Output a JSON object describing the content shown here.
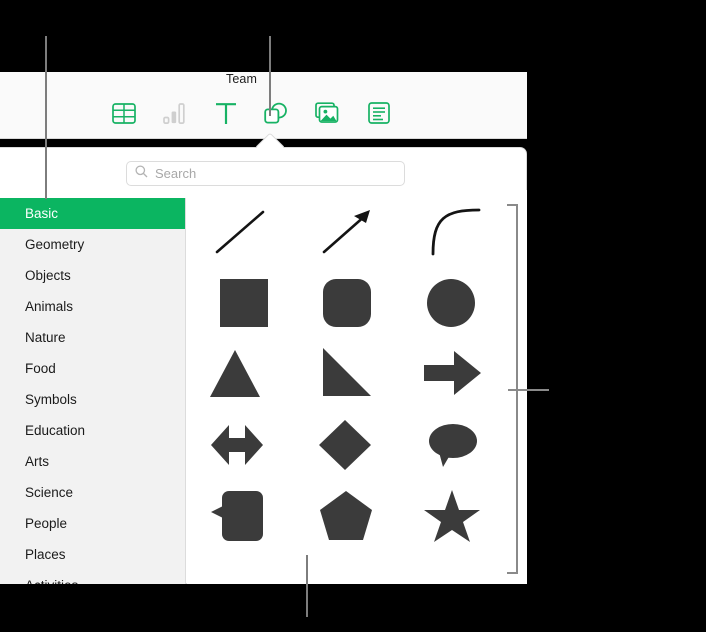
{
  "window": {
    "toolbar_title": "Team",
    "accent_color": "#0bb561",
    "toolbar_icons": [
      {
        "name": "table-icon",
        "label": "Table",
        "state": "enabled"
      },
      {
        "name": "chart-icon",
        "label": "Chart",
        "state": "disabled"
      },
      {
        "name": "text-icon",
        "label": "Text",
        "state": "enabled"
      },
      {
        "name": "shape-icon",
        "label": "Shape",
        "state": "active"
      },
      {
        "name": "media-icon",
        "label": "Media",
        "state": "enabled"
      },
      {
        "name": "comment-icon",
        "label": "Comment",
        "state": "enabled"
      }
    ]
  },
  "popover": {
    "search": {
      "placeholder": "Search",
      "value": "",
      "icon": "search-icon"
    },
    "categories": [
      {
        "label": "Basic",
        "selected": true
      },
      {
        "label": "Geometry",
        "selected": false
      },
      {
        "label": "Objects",
        "selected": false
      },
      {
        "label": "Animals",
        "selected": false
      },
      {
        "label": "Nature",
        "selected": false
      },
      {
        "label": "Food",
        "selected": false
      },
      {
        "label": "Symbols",
        "selected": false
      },
      {
        "label": "Education",
        "selected": false
      },
      {
        "label": "Arts",
        "selected": false
      },
      {
        "label": "Science",
        "selected": false
      },
      {
        "label": "People",
        "selected": false
      },
      {
        "label": "Places",
        "selected": false
      },
      {
        "label": "Activities",
        "selected": false
      }
    ],
    "shapes": [
      {
        "name": "line-shape",
        "label": "Line"
      },
      {
        "name": "arrow-shape",
        "label": "Arrow"
      },
      {
        "name": "curved-line-shape",
        "label": "Curved Line"
      },
      {
        "name": "square-shape",
        "label": "Square"
      },
      {
        "name": "rounded-square-shape",
        "label": "Rounded Square"
      },
      {
        "name": "circle-shape",
        "label": "Circle"
      },
      {
        "name": "triangle-shape",
        "label": "Triangle"
      },
      {
        "name": "right-triangle-shape",
        "label": "Right Triangle"
      },
      {
        "name": "right-arrow-shape",
        "label": "Right Arrow"
      },
      {
        "name": "double-arrow-shape",
        "label": "Double Arrow"
      },
      {
        "name": "diamond-shape",
        "label": "Diamond"
      },
      {
        "name": "speech-bubble-shape",
        "label": "Speech Bubble"
      },
      {
        "name": "rounded-callout-shape",
        "label": "Rounded Callout"
      },
      {
        "name": "pentagon-shape",
        "label": "Pentagon"
      },
      {
        "name": "star-shape",
        "label": "Star"
      }
    ],
    "shape_fill_color": "#3b3b3b"
  },
  "annotations": {
    "callout_color": "#7d7d7d",
    "leaders": [
      {
        "name": "callout-leader-categories",
        "target": "category-list"
      },
      {
        "name": "callout-leader-shape-button",
        "target": "shape-toolbar-button"
      },
      {
        "name": "callout-leader-shapes-grid",
        "target": "shapes-grid"
      },
      {
        "name": "callout-bracket-shapes",
        "target": "shapes-grid"
      }
    ]
  }
}
